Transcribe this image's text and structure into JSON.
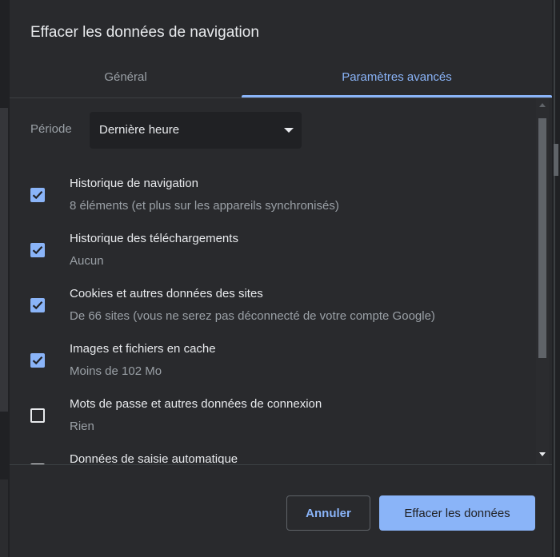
{
  "dialog": {
    "title": "Effacer les données de navigation"
  },
  "tabs": [
    {
      "label": "Général",
      "active": false
    },
    {
      "label": "Paramètres avancés",
      "active": true
    }
  ],
  "period": {
    "label": "Période",
    "value": "Dernière heure"
  },
  "items": [
    {
      "title": "Historique de navigation",
      "subtitle": "8 éléments (et plus sur les appareils synchronisés)",
      "checked": true
    },
    {
      "title": "Historique des téléchargements",
      "subtitle": "Aucun",
      "checked": true
    },
    {
      "title": "Cookies et autres données des sites",
      "subtitle": "De 66 sites (vous ne serez pas déconnecté de votre compte Google)",
      "checked": true
    },
    {
      "title": "Images et fichiers en cache",
      "subtitle": "Moins de 102 Mo",
      "checked": true
    },
    {
      "title": "Mots de passe et autres données de connexion",
      "subtitle": "Rien",
      "checked": false
    },
    {
      "title": "Données de saisie automatique",
      "subtitle": "",
      "checked": false
    }
  ],
  "buttons": {
    "cancel": "Annuler",
    "clear": "Effacer les données"
  },
  "colors": {
    "accent": "#8ab4f8",
    "dialog_bg": "#292a2d",
    "text_primary": "#e8eaed",
    "text_secondary": "#9aa0a6"
  }
}
